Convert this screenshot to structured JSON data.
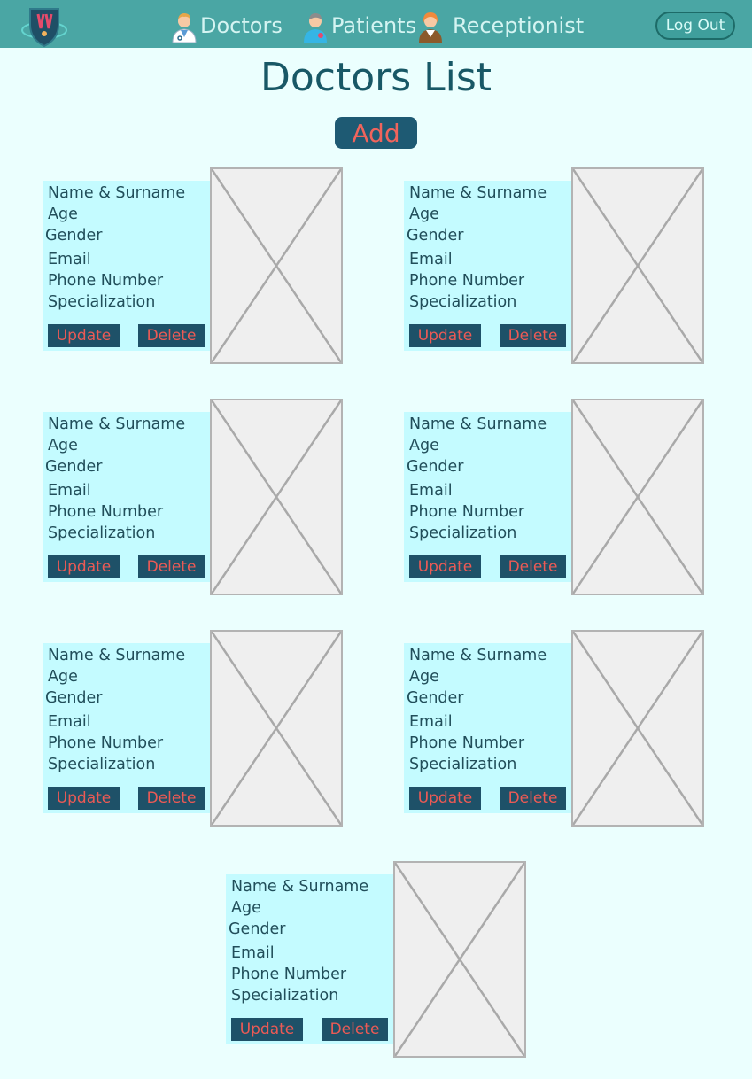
{
  "nav": {
    "doctors": "Doctors",
    "patients": "Patients",
    "receptionist": "Receptionist",
    "logout": "Log Out"
  },
  "page": {
    "title": "Doctors List",
    "add_label": "Add"
  },
  "card_labels": {
    "name": "Name & Surname",
    "age": "Age",
    "gender": "Gender",
    "email": "Email",
    "phone": "Phone Number",
    "specialization": "Specialization",
    "update": "Update",
    "delete": "Delete"
  },
  "doctors_count": 7,
  "colors": {
    "navbar": "#4aa6a4",
    "background": "#ebfffe",
    "card": "#c4fbff",
    "button": "#1e5168",
    "button_text": "#ec5a55",
    "title": "#185866"
  },
  "icons": {
    "logo": "medical-shield-logo",
    "doctors": "doctor-avatar-icon",
    "patients": "patient-avatar-icon",
    "receptionist": "receptionist-avatar-icon",
    "photo": "image-placeholder-icon"
  }
}
